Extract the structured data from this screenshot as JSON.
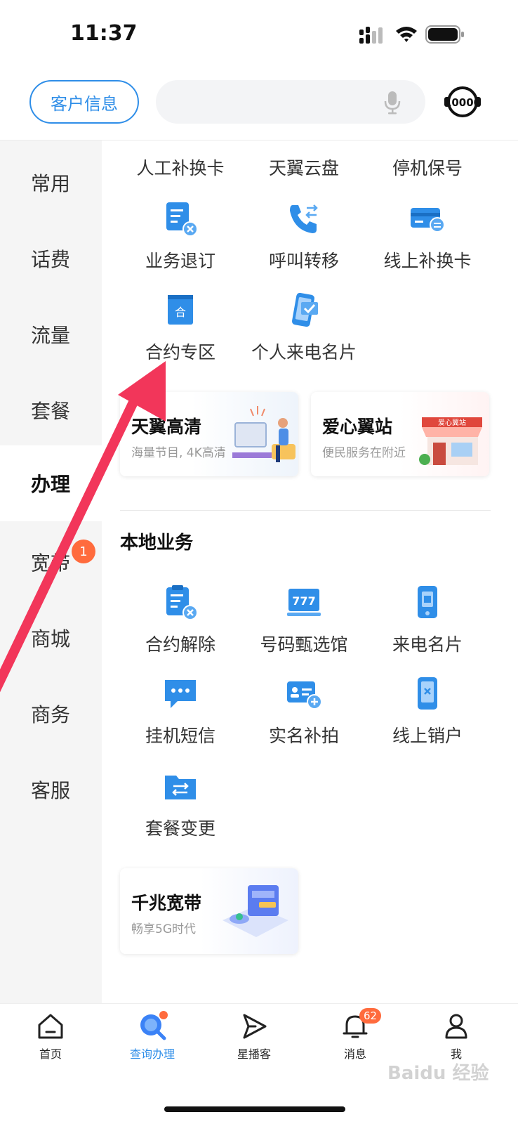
{
  "status_bar": {
    "time": "11:37"
  },
  "header": {
    "customer_info_label": "客户信息",
    "hotline_icon": "10000-hotline-icon",
    "search_placeholder": ""
  },
  "sidebar": {
    "items": [
      {
        "label": "常用"
      },
      {
        "label": "话费"
      },
      {
        "label": "流量"
      },
      {
        "label": "套餐"
      },
      {
        "label": "办理",
        "active": true
      },
      {
        "label": "宽带",
        "badge": "1"
      },
      {
        "label": "商城"
      },
      {
        "label": "商务"
      },
      {
        "label": "客服"
      }
    ]
  },
  "services": {
    "top_row": [
      "人工补换卡",
      "天翼云盘",
      "停机保号"
    ],
    "row2": [
      {
        "label": "业务退订",
        "icon": "document-cancel-icon"
      },
      {
        "label": "呼叫转移",
        "icon": "call-forward-icon"
      },
      {
        "label": "线上补换卡",
        "icon": "sim-card-swap-icon"
      }
    ],
    "row3": [
      {
        "label": "合约专区",
        "icon": "contract-book-icon"
      },
      {
        "label": "个人来电名片",
        "icon": "phone-check-icon"
      }
    ]
  },
  "promos": [
    {
      "title": "天翼高清",
      "subtitle": "海量节目, 4K高清"
    },
    {
      "title": "爱心翼站",
      "subtitle": "便民服务在附近",
      "sign": "爱心翼站"
    }
  ],
  "local": {
    "section_title": "本地业务",
    "row1": [
      {
        "label": "合约解除",
        "icon": "clipboard-cancel-icon"
      },
      {
        "label": "号码甄选馆",
        "icon": "number-display-icon"
      },
      {
        "label": "来电名片",
        "icon": "phone-card-icon"
      }
    ],
    "row2": [
      {
        "label": "挂机短信",
        "icon": "chat-bubble-icon"
      },
      {
        "label": "实名补拍",
        "icon": "id-card-add-icon"
      },
      {
        "label": "线上销户",
        "icon": "phone-cancel-icon"
      }
    ],
    "row3": [
      {
        "label": "套餐变更",
        "icon": "folder-swap-icon"
      }
    ],
    "promo": {
      "title": "千兆宽带",
      "subtitle": "畅享5G时代"
    }
  },
  "bottom_nav": {
    "items": [
      {
        "label": "首页",
        "icon": "home-icon"
      },
      {
        "label": "查询办理",
        "icon": "search-service-icon",
        "active": true,
        "dot": true
      },
      {
        "label": "星播客",
        "icon": "play-arrow-icon"
      },
      {
        "label": "消息",
        "icon": "bell-icon",
        "badge": "62"
      },
      {
        "label": "我",
        "icon": "profile-icon"
      }
    ]
  },
  "watermark": "Baidu 经验",
  "colors": {
    "accent": "#2f8ee8",
    "badge": "#ff6b3d",
    "annotation_arrow": "#f2365a",
    "sidebar_bg": "#f5f5f5"
  }
}
